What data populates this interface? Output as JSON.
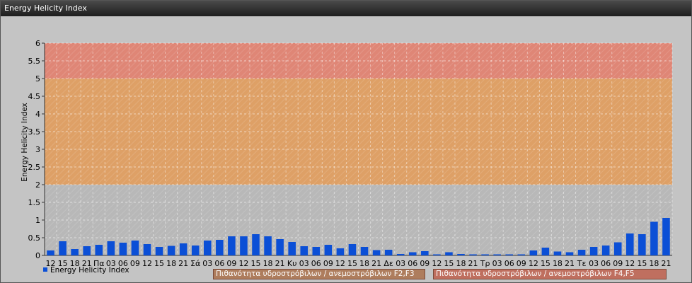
{
  "window": {
    "title": "Energy Helicity Index"
  },
  "colors": {
    "bar": "#0b4fd6",
    "band_low": "#b8b8b8",
    "band_mid": "#dea066",
    "band_high": "#df8676",
    "legend_mid_bg": "#ae7d5d",
    "legend_high_bg": "#bf6f5f"
  },
  "legend": {
    "series": "Energy Helicity Index",
    "band_mid": "Πιθανότητα υδροστρόβιλων / ανεμοστρόβιλων F2,F3",
    "band_high": "Πιθανότητα υδροστρόβιλων / ανεμοστρόβιλων F4,F5"
  },
  "chart_data": {
    "type": "bar",
    "ylabel": "Energy Helicity Index",
    "ylim": [
      0,
      6
    ],
    "yticks": [
      "0",
      "0.5",
      "1",
      "1.5",
      "2",
      "2.5",
      "3",
      "3.5",
      "4",
      "4.5",
      "5",
      "5.5",
      "6"
    ],
    "grid": true,
    "bands": [
      {
        "from": 2,
        "to": 5,
        "label": "Πιθανότητα υδροστρόβιλων / ανεμοστρόβιλων F2,F3"
      },
      {
        "from": 5,
        "to": 6,
        "label": "Πιθανότητα υδροστρόβιλων / ανεμοστρόβιλων F4,F5"
      }
    ],
    "categories": [
      "12",
      "15",
      "18",
      "21",
      "Πα",
      "03",
      "06",
      "09",
      "12",
      "15",
      "18",
      "21",
      "Σά",
      "03",
      "06",
      "09",
      "12",
      "15",
      "18",
      "21",
      "Κυ",
      "03",
      "06",
      "09",
      "12",
      "15",
      "18",
      "21",
      "Δε",
      "03",
      "06",
      "09",
      "12",
      "15",
      "18",
      "21",
      "Τρ",
      "03",
      "06",
      "09",
      "12",
      "15",
      "18",
      "21",
      "Τε",
      "03",
      "06",
      "09",
      "12",
      "15",
      "18",
      "21"
    ],
    "series": [
      {
        "name": "Energy Helicity Index",
        "values": [
          0.14,
          0.4,
          0.18,
          0.26,
          0.3,
          0.4,
          0.36,
          0.42,
          0.32,
          0.24,
          0.27,
          0.34,
          0.28,
          0.42,
          0.44,
          0.54,
          0.54,
          0.6,
          0.54,
          0.46,
          0.38,
          0.26,
          0.24,
          0.3,
          0.2,
          0.32,
          0.24,
          0.15,
          0.16,
          0.04,
          0.09,
          0.12,
          0.03,
          0.09,
          0.04,
          0.03,
          0.03,
          0.03,
          0.03,
          0.03,
          0.14,
          0.22,
          0.11,
          0.09,
          0.16,
          0.24,
          0.28,
          0.37,
          0.62,
          0.6,
          0.95,
          1.06
        ]
      }
    ]
  }
}
